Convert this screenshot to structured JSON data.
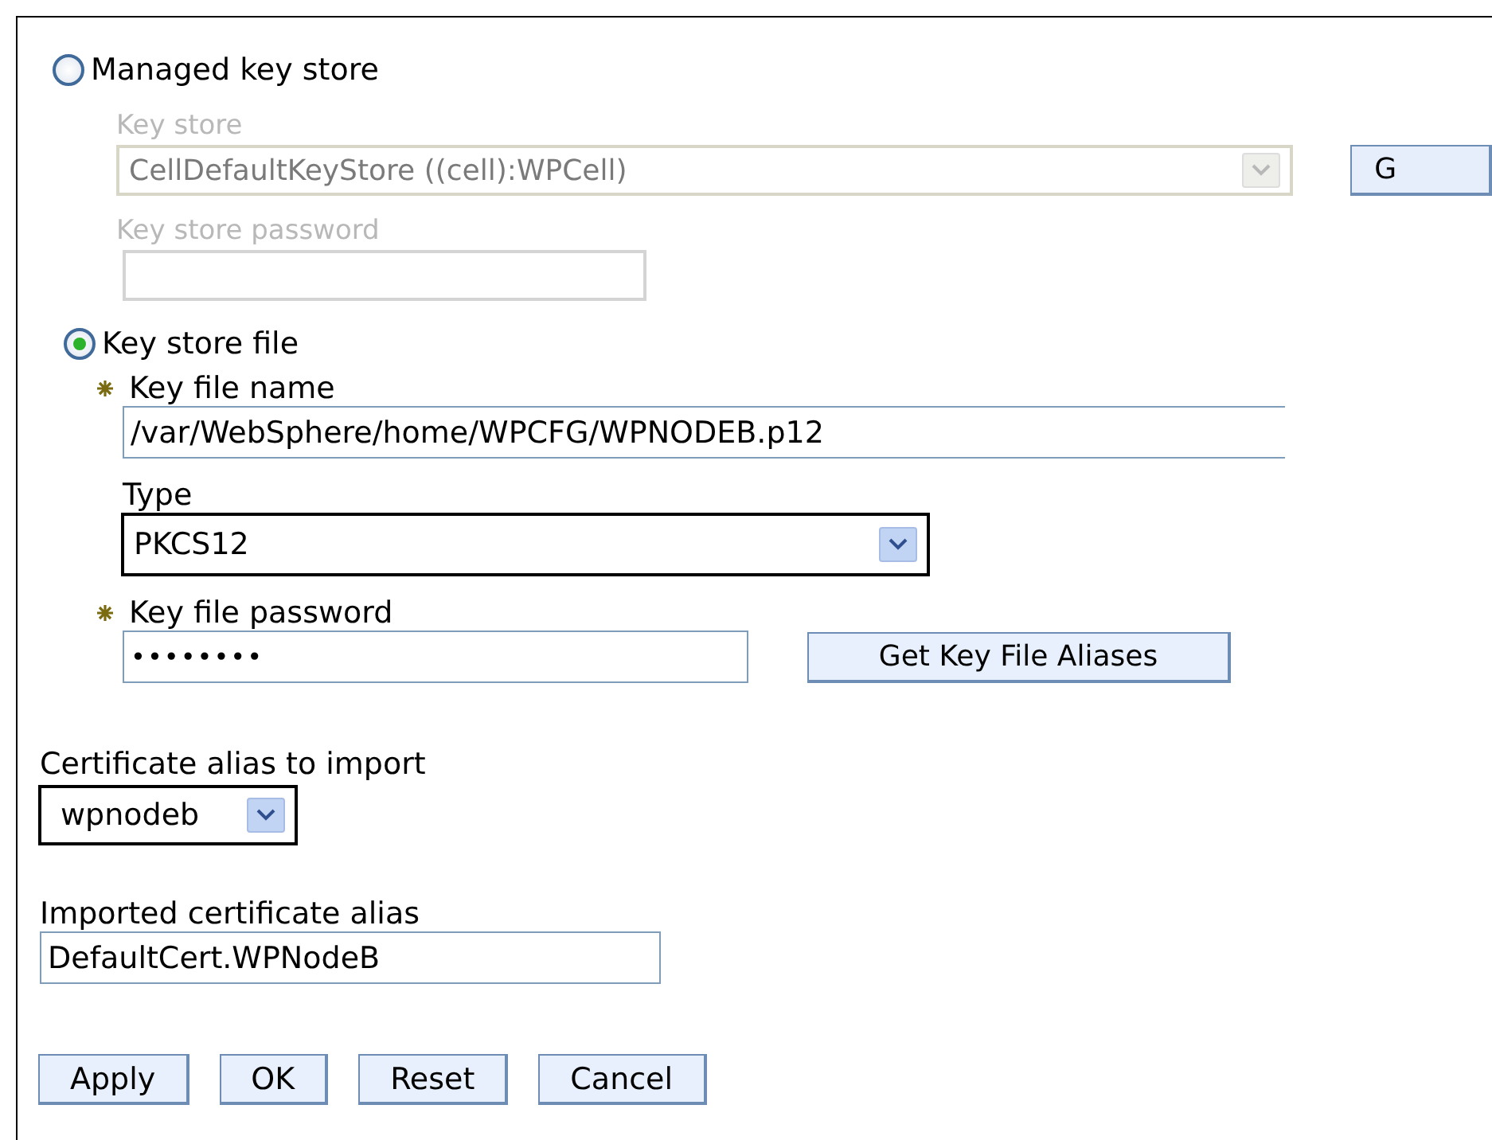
{
  "managed_key_store": {
    "radio": {
      "label": "Managed key store",
      "selected": false
    },
    "disabled": true,
    "key_store": {
      "label": "Key store",
      "value": "CellDefaultKeyStore ((cell):WPCell)"
    },
    "side_button": "G",
    "password": {
      "label": "Key store password"
    }
  },
  "key_store_file": {
    "radio": {
      "label": "Key store file",
      "selected": true
    },
    "key_file_name": {
      "label": "Key file name",
      "required": true,
      "value": "/var/WebSphere/home/WPCFG/WPNODEB.p12"
    },
    "type": {
      "label": "Type",
      "value": "PKCS12"
    },
    "key_file_password": {
      "label": "Key file password",
      "required": true,
      "value": "••••••••"
    },
    "aliases_button": "Get Key File Aliases"
  },
  "certificate_alias": {
    "label": "Certificate alias to import",
    "value": "wpnodeb"
  },
  "imported_alias": {
    "label": "Imported certificate alias",
    "value": "DefaultCert.WPNodeB"
  },
  "buttons": [
    "Apply",
    "OK",
    "Reset",
    "Cancel"
  ]
}
